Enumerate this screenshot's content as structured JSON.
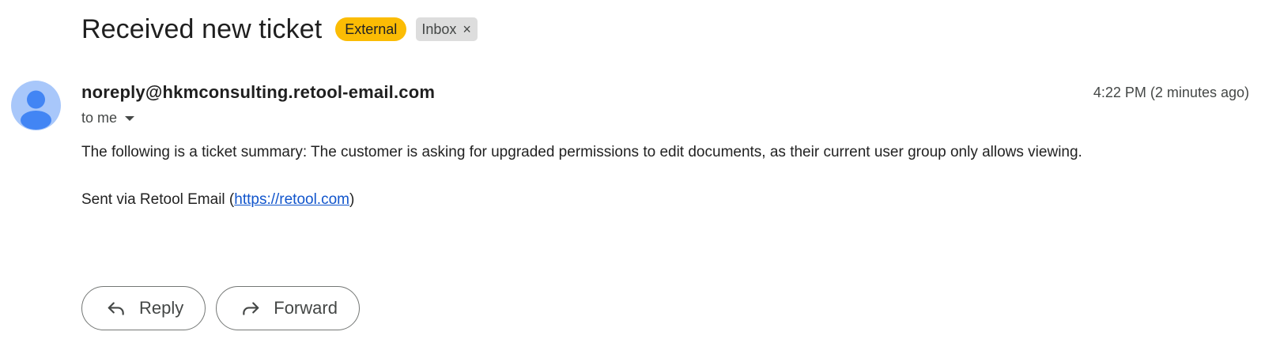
{
  "email": {
    "subject": "Received new ticket",
    "labels": {
      "external": "External",
      "inbox": "Inbox",
      "inbox_remove": "×"
    },
    "sender": "noreply@hkmconsulting.retool-email.com",
    "timestamp": "4:22 PM (2 minutes ago)",
    "recipient": "to me",
    "body": "The following is a ticket summary: The customer is asking for upgraded permissions to edit documents, as their current user group only allows viewing.",
    "footer_prefix": "Sent via Retool Email (",
    "footer_link": "https://retool.com",
    "footer_suffix": ")"
  },
  "actions": {
    "reply_label": "Reply",
    "forward_label": "Forward"
  },
  "icons": {
    "avatar": "person-icon",
    "reply": "reply-icon",
    "forward": "forward-icon",
    "recipient_menu": "caret-down-icon",
    "remove_label": "close-icon"
  },
  "colors": {
    "external_label": "#fbbc04",
    "inbox_label": "#dddddd",
    "avatar_bg": "#a8c7fa",
    "avatar_fg": "#4285f4",
    "link": "#1155cc"
  }
}
